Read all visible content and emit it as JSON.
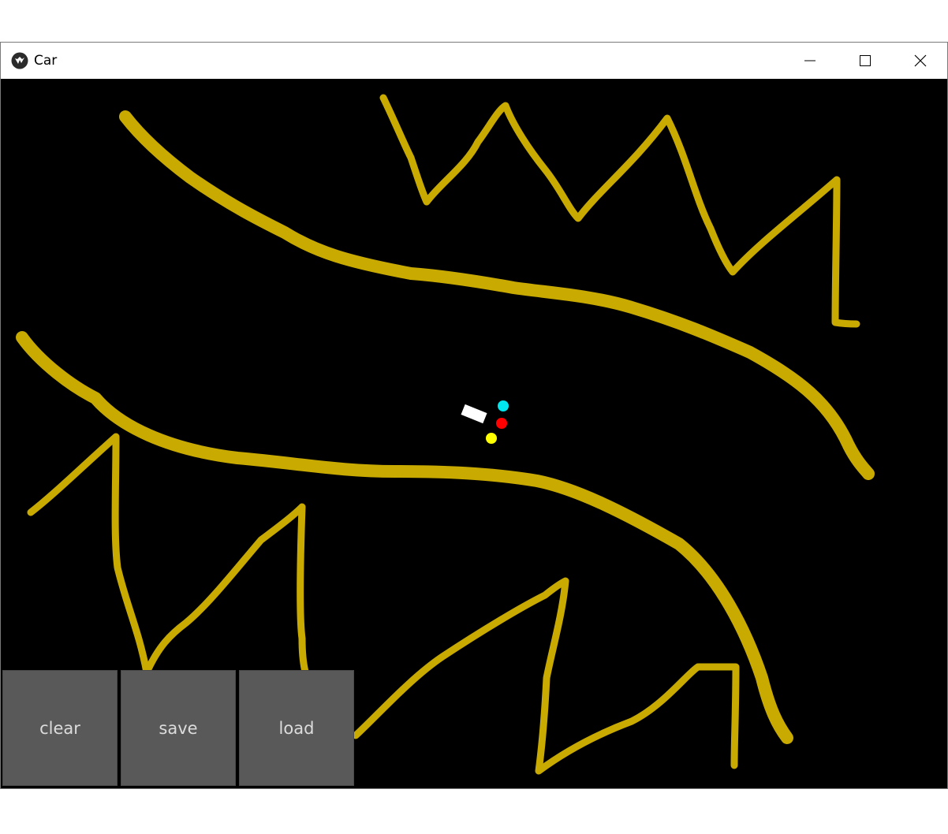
{
  "window": {
    "title": "Car"
  },
  "toolbar": {
    "clear_label": "clear",
    "save_label": "save",
    "load_label": "load"
  },
  "colors": {
    "road_line": "#c8aa00",
    "background": "#000000",
    "car": "#ffffff",
    "sensor_1": "#00e5ee",
    "sensor_2": "#ff0000",
    "sensor_3": "#ffff00",
    "button": "#595959"
  },
  "icons": {
    "app": "kivy-logo-icon",
    "minimize": "minimize-icon",
    "maximize": "maximize-icon",
    "close": "close-icon"
  }
}
